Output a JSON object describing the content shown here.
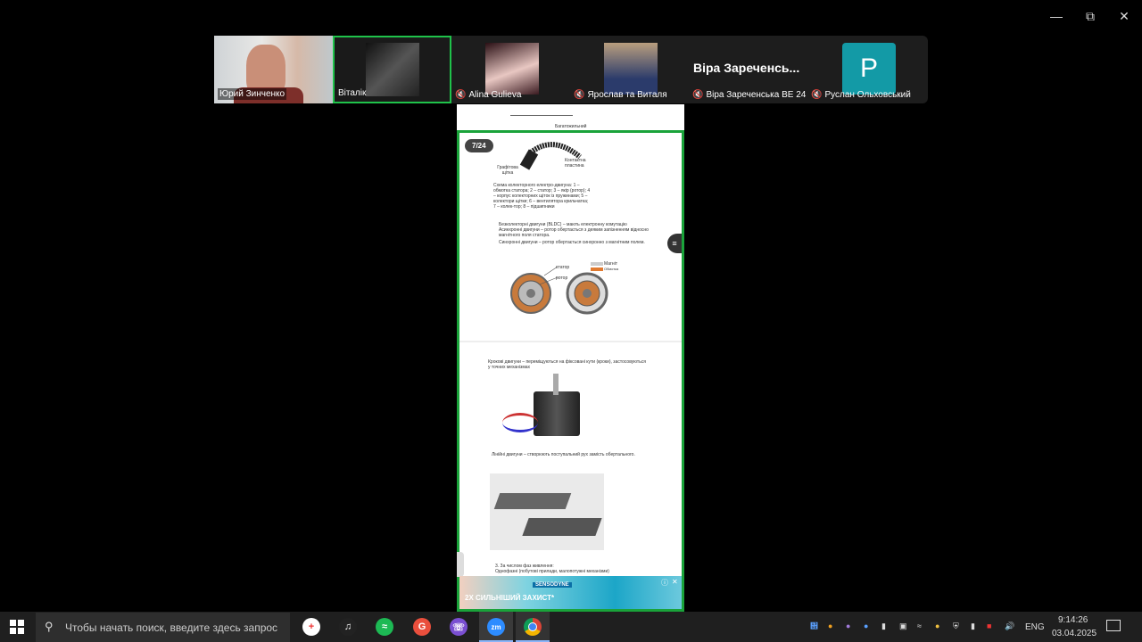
{
  "participants": [
    {
      "name": "Юрий Зинченко",
      "muted": false
    },
    {
      "name": "Віталік",
      "muted": false
    },
    {
      "name": "Alina Gulieva",
      "muted": true
    },
    {
      "name": "Ярослав та Виталя",
      "muted": true
    },
    {
      "name": "Віра Зареченська ВЕ 24",
      "muted": true,
      "display_title": "Віра  Зареченсь..."
    },
    {
      "name": "Руслан Ольховський",
      "muted": true,
      "avatar_letter": "P"
    }
  ],
  "document": {
    "page_badge": "7/24",
    "labels": {
      "multi": "Багатожильний",
      "graphite": "Графітова щітка",
      "contact": "Контактна пластина"
    },
    "scheme_caption": "Схема колекторного електро-двигуна: 1 – обмотка статора; 2 – статор; 3 – якір (ротор); 4 – корпус колекторних щіток із пружинами; 5 – колектори щітки; 6 – вентилятора крильчатка; 7 – колек-тор; 8 – підшипники",
    "bldc": "Безколекторні двигуни (BLDC) – мають електронну комутацію",
    "async": "Асинхронні двигуни – ротор обертається з деяким запізненням відносно магнітного поля статора.",
    "sync": "Синхронні двигуни – ротор обертається синхронно з магнітним полем.",
    "legend_magnet": "Магніт",
    "legend_winding": "Обмотка",
    "stator_label": "статор",
    "rotor_label": "ротор",
    "stepper": "Крокові двигуни – переміщуються на фіксовані кути (кроки), застосовуються у точних механізмах",
    "linear": "Лінійні двигуни – створюють поступальний рух замість обертального.",
    "phases_title": "3. За числом фаз живлення:",
    "phases_item": "Однофазні (побутові прилади, малопотужні механізми)"
  },
  "ad": {
    "brand": "SENSODYNE",
    "headline": "2Х СИЛЬНІШИЙ ЗАХИСТ*"
  },
  "taskbar": {
    "search_placeholder": "Чтобы начать поиск, введите здесь запрос",
    "language": "ENG",
    "time": "9:14:26",
    "date": "03.04.2025"
  }
}
